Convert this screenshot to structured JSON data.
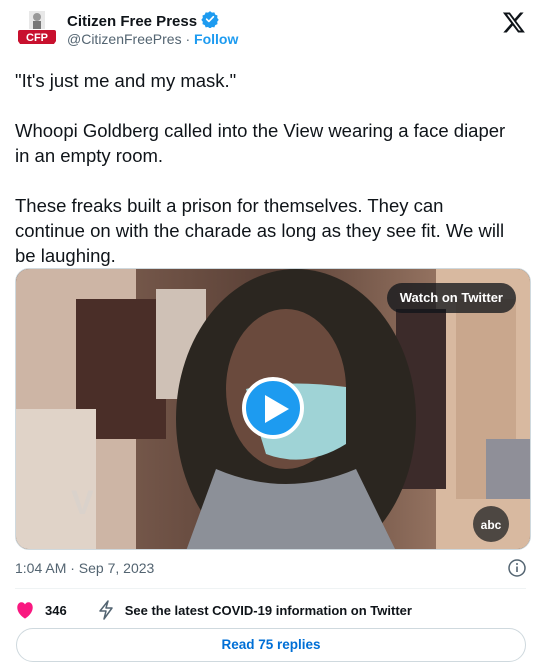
{
  "author": {
    "name": "Citizen Free Press",
    "handle": "@CitizenFreePres",
    "separator": "·",
    "follow_label": "Follow",
    "logo_text": "CFP"
  },
  "tweet": {
    "paragraphs": [
      "\"It's just me and my mask.\"",
      "Whoopi Goldberg called into the View wearing a face diaper in an empty room.",
      "These freaks built a prison for themselves. They can continue on with the charade as long as they see fit. We will be laughing."
    ]
  },
  "media": {
    "watch_label": "Watch on Twitter",
    "watermark": "abc"
  },
  "meta": {
    "timestamp": "1:04 AM · Sep 7, 2023"
  },
  "actions": {
    "like_count": "346",
    "covid_label": "See the latest COVID-19 information on Twitter"
  },
  "replies": {
    "label": "Read 75 replies"
  },
  "colors": {
    "accent": "#1d9bf0",
    "heart": "#f91880",
    "link": "#006fd6",
    "muted": "#536471"
  },
  "icons": [
    "verified-badge-icon",
    "x-logo-icon",
    "play-icon",
    "info-icon",
    "heart-icon",
    "lightning-icon"
  ]
}
